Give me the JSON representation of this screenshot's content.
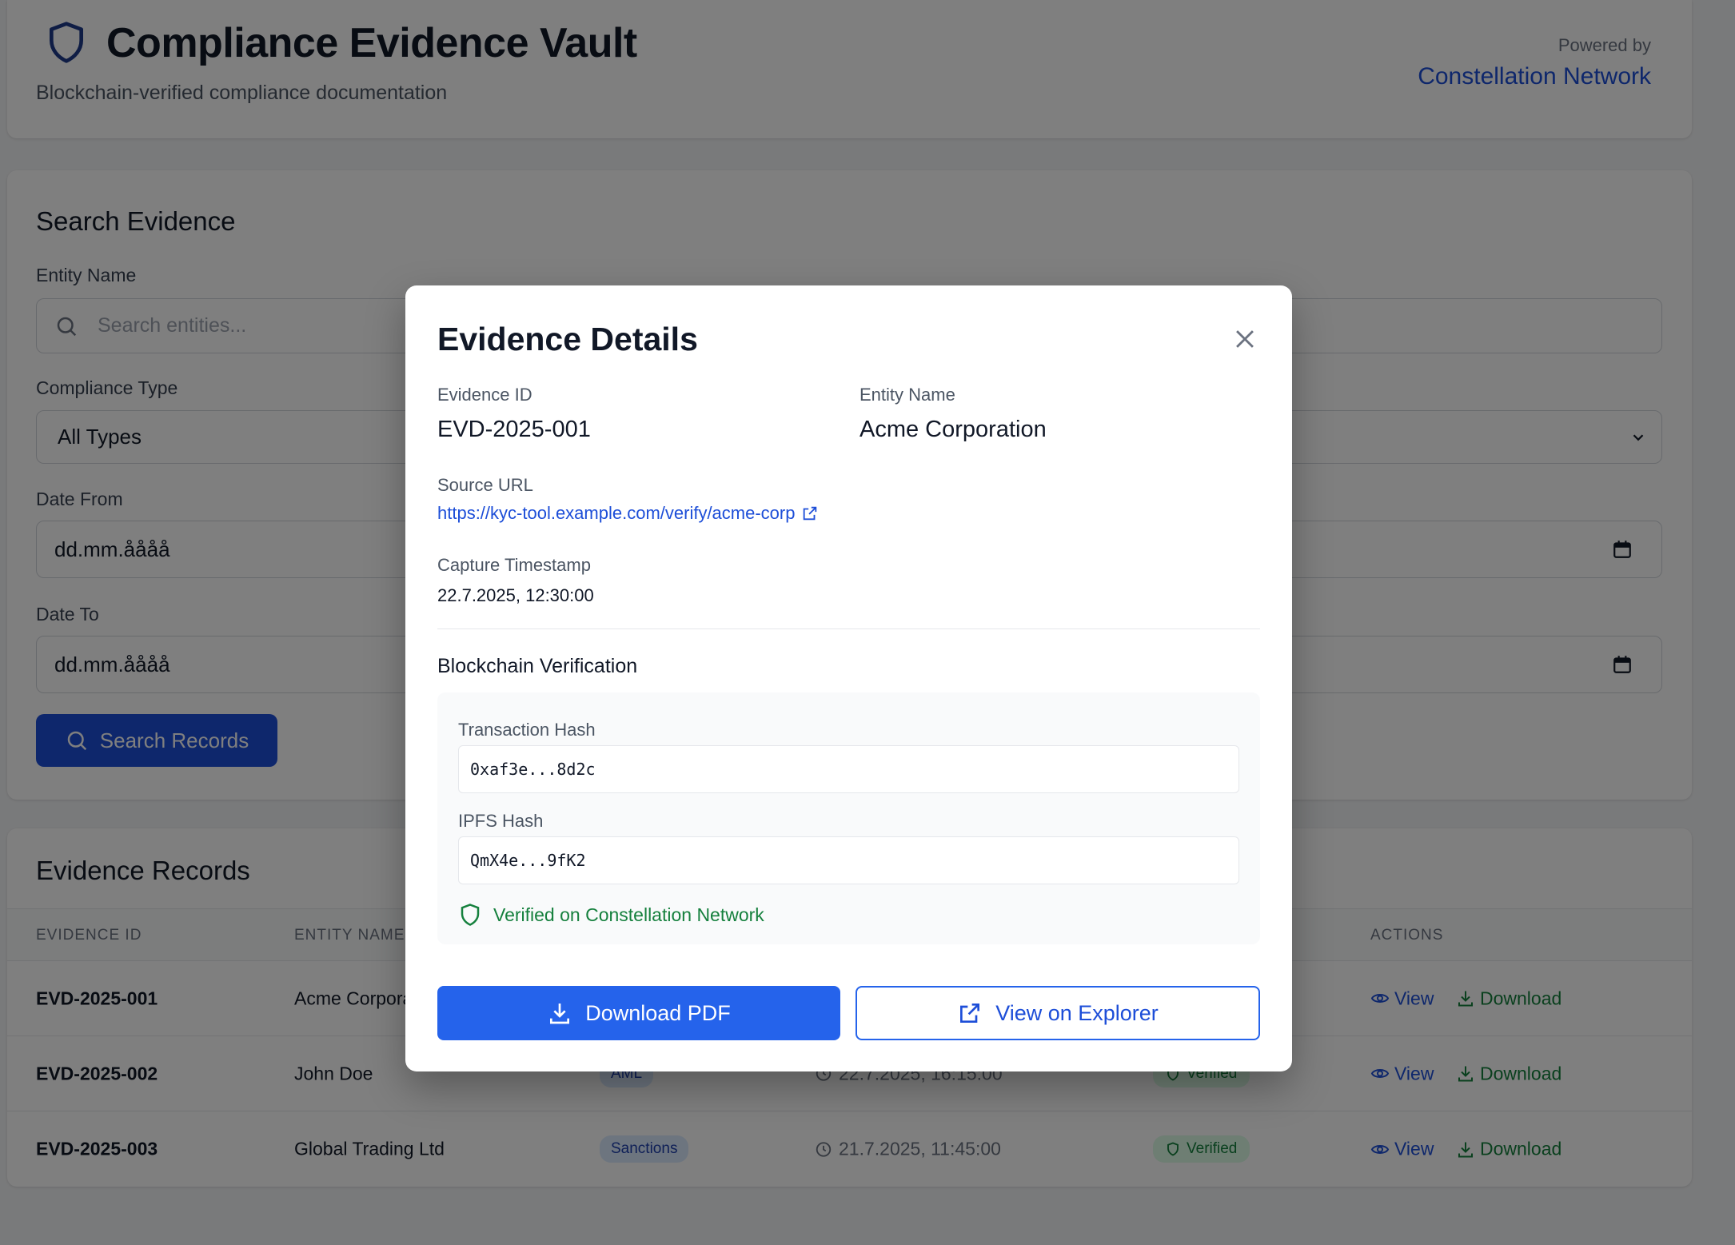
{
  "header": {
    "title": "Compliance Evidence Vault",
    "subtitle": "Blockchain-verified compliance documentation",
    "powered_label": "Powered by",
    "powered_link": "Constellation Network",
    "brand_color": "#1e3a8a"
  },
  "search": {
    "title": "Search Evidence",
    "entity_label": "Entity Name",
    "entity_placeholder": "Search entities...",
    "type_label": "Compliance Type",
    "type_value": "All Types",
    "date_from_label": "Date From",
    "date_from_value": "dd.mm.åååå",
    "date_to_label": "Date To",
    "date_to_value": "dd.mm.åååå",
    "button_label": "Search Records"
  },
  "records": {
    "title": "Evidence Records",
    "columns": [
      "EVIDENCE ID",
      "ENTITY NAME",
      "ACTIONS"
    ],
    "rows": [
      {
        "id": "EVD-2025-001",
        "entity": "Acme Corporation",
        "type": "",
        "timestamp": "",
        "status": "",
        "view": "View",
        "download": "Download"
      },
      {
        "id": "EVD-2025-002",
        "entity": "John Doe",
        "type": "AML",
        "timestamp": "22.7.2025, 16:15:00",
        "status": "Verified",
        "view": "View",
        "download": "Download"
      },
      {
        "id": "EVD-2025-003",
        "entity": "Global Trading Ltd",
        "type": "Sanctions",
        "timestamp": "21.7.2025, 11:45:00",
        "status": "Verified",
        "view": "View",
        "download": "Download"
      }
    ]
  },
  "modal": {
    "title": "Evidence Details",
    "evidence_id_label": "Evidence ID",
    "evidence_id": "EVD-2025-001",
    "entity_label": "Entity Name",
    "entity": "Acme Corporation",
    "source_label": "Source URL",
    "source_url": "https://kyc-tool.example.com/verify/acme-corp",
    "timestamp_label": "Capture Timestamp",
    "timestamp": "22.7.2025, 12:30:00",
    "verification_title": "Blockchain Verification",
    "tx_label": "Transaction Hash",
    "tx_hash": "0xaf3e...8d2c",
    "ipfs_label": "IPFS Hash",
    "ipfs_hash": "QmX4e...9fK2",
    "verified_text": "Verified on Constellation Network",
    "download_button": "Download PDF",
    "explorer_button": "View on Explorer",
    "accent_color": "#2563eb",
    "success_color": "#15803d"
  },
  "icons": [
    "shield-icon",
    "search-icon",
    "chevron-down-icon",
    "calendar-icon",
    "clock-icon",
    "eye-icon",
    "download-icon",
    "close-icon",
    "external-link-icon",
    "shield-check-icon"
  ]
}
